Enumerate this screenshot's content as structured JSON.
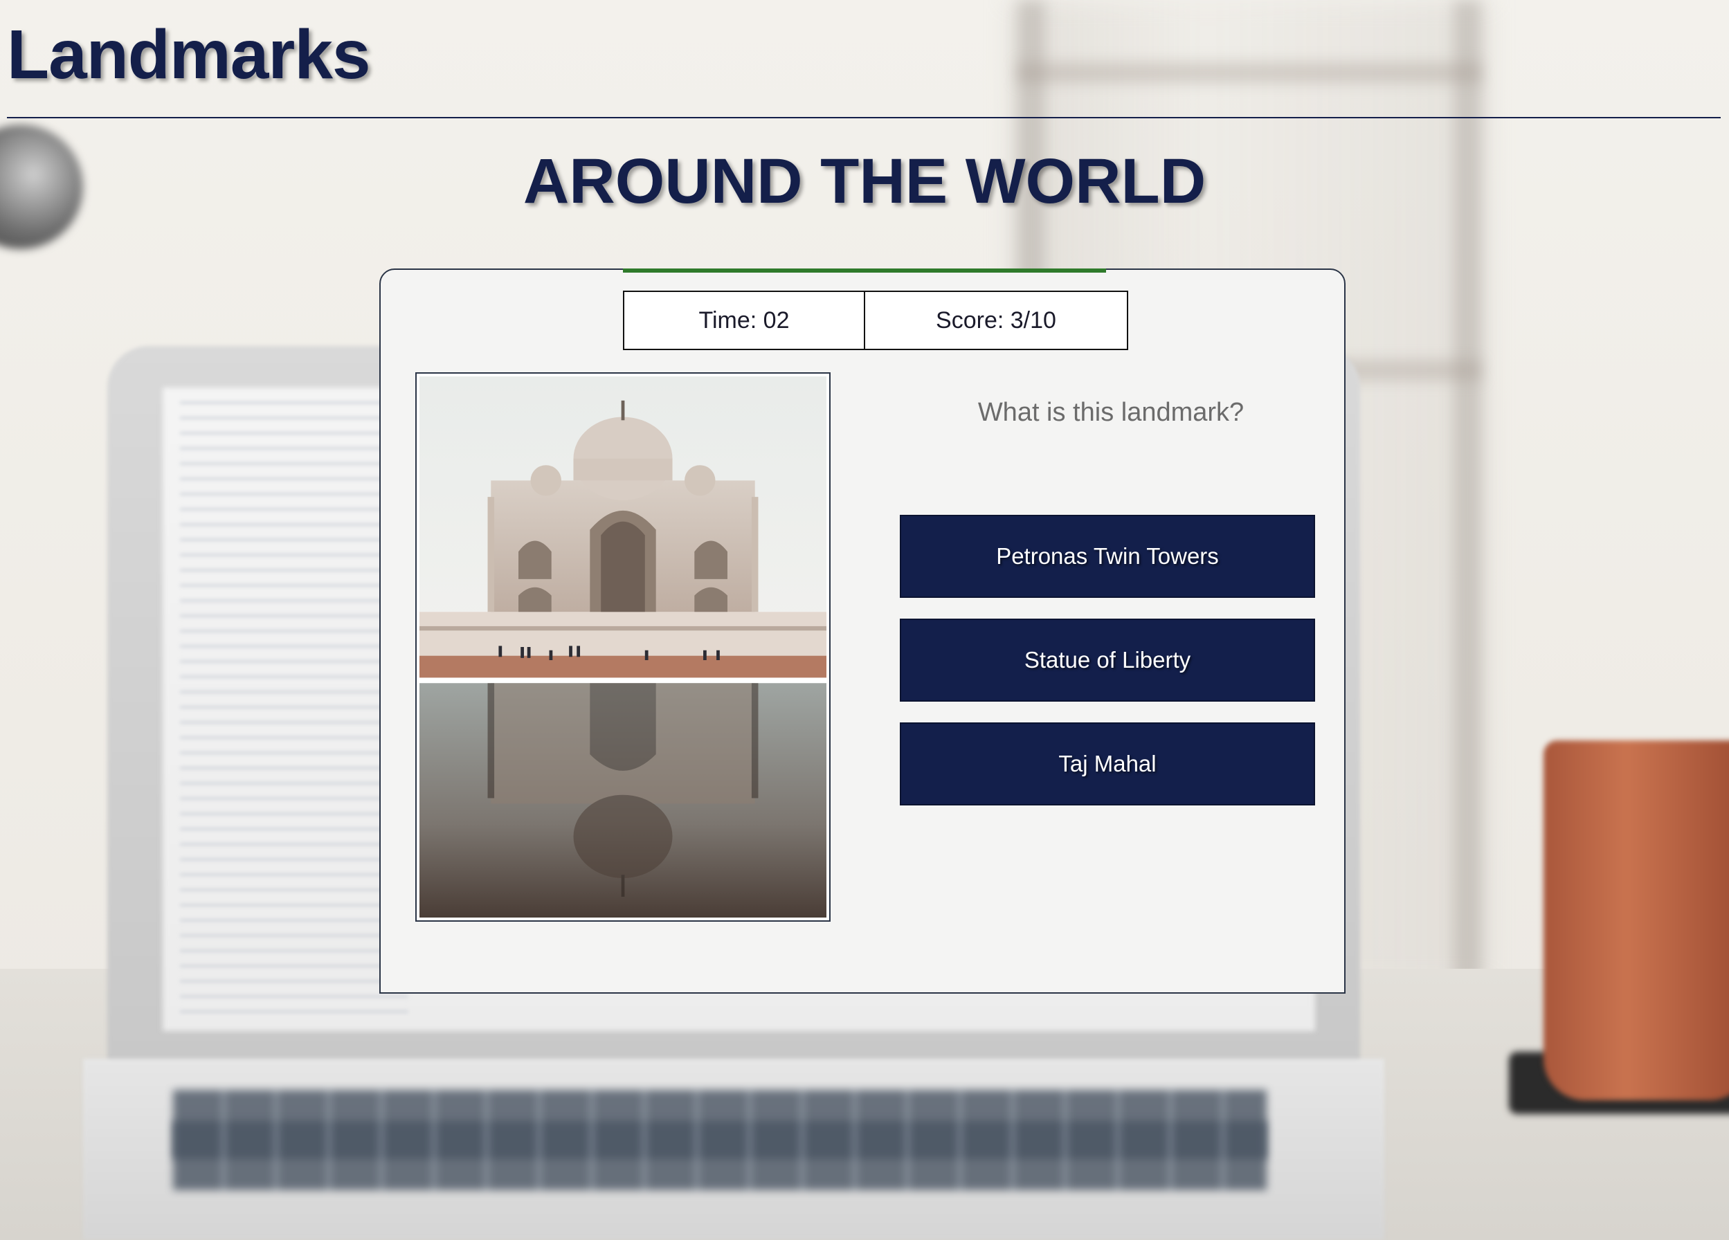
{
  "header": {
    "site_title": "Landmarks",
    "game_heading": "AROUND THE WORLD"
  },
  "quiz": {
    "progress_fraction": 0.3,
    "time_label": "Time: 02",
    "score_label": "Score: 3/10",
    "question": "What is this landmark?",
    "image_subject": "taj-mahal-photo",
    "answers": [
      {
        "label": "Petronas Twin Towers"
      },
      {
        "label": "Statue of Liberty"
      },
      {
        "label": "Taj Mahal"
      }
    ]
  },
  "colors": {
    "navy": "#131f4b",
    "progress_green": "#2f7a2b",
    "card_bg": "#f4f4f3"
  }
}
